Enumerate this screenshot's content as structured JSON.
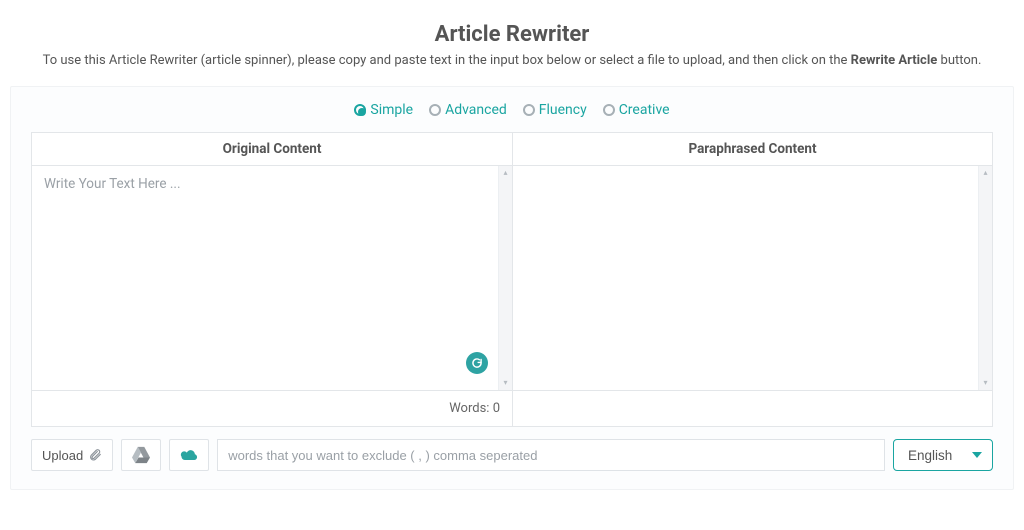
{
  "title": "Article Rewriter",
  "subtitle_prefix": "To use this Article Rewriter (article spinner), please copy and paste text in the input box below or select a file to upload, and then click on the ",
  "subtitle_bold": "Rewrite Article",
  "subtitle_suffix": " button.",
  "modes": [
    {
      "label": "Simple",
      "selected": true
    },
    {
      "label": "Advanced",
      "selected": false
    },
    {
      "label": "Fluency",
      "selected": false
    },
    {
      "label": "Creative",
      "selected": false
    }
  ],
  "panels": {
    "original": {
      "header": "Original Content",
      "placeholder": "Write Your Text Here ...",
      "words_label": "Words:",
      "words_count": "0"
    },
    "paraphrased": {
      "header": "Paraphrased Content"
    }
  },
  "toolbar": {
    "upload_label": "Upload",
    "exclude_placeholder": "words that you want to exclude ( , ) comma seperated",
    "language": "English"
  }
}
